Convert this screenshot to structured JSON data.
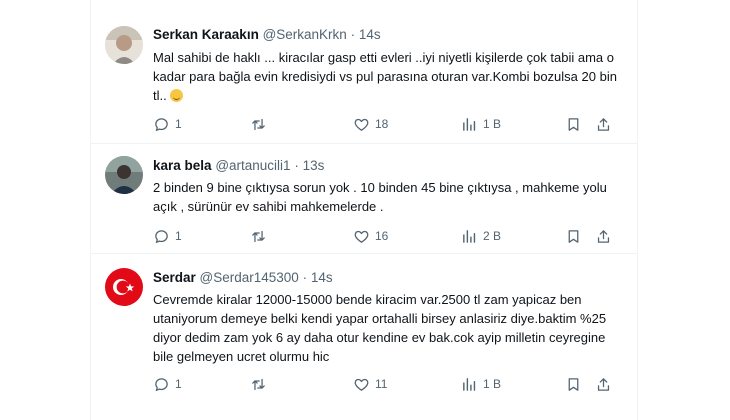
{
  "tweets": [
    {
      "name": "Serkan Karaakın",
      "handle": "@SerkanKrkn",
      "dot": "·",
      "time": "14s",
      "text": "Mal sahibi de haklı ... kiracılar gasp etti evleri ..iyi niyetli kişilerde çok tabii ama o kadar para bağla evin kredisiydi vs pul parasına oturan var.Kombi bozulsa 20 bin tl..",
      "emoji": "grinning-face",
      "replies": "1",
      "retweets": "",
      "likes": "18",
      "views": "1 B"
    },
    {
      "name": "kara bela",
      "handle": "@artanucili1",
      "dot": "·",
      "time": "13s",
      "text": "2 binden 9 bine çıktıysa sorun yok . 10 binden 45 bine çıktıysa , mahkeme yolu açık , sürünür ev sahibi mahkemelerde .",
      "replies": "1",
      "retweets": "",
      "likes": "16",
      "views": "2 B"
    },
    {
      "name": "Serdar",
      "handle": "@Serdar145300",
      "dot": "·",
      "time": "14s",
      "text": "Cevremde kiralar 12000-15000 bende kiracim var.2500 tl zam yapicaz ben utaniyorum demeye belki kendi yapar ortahalli birsey anlasiriz diye.baktim %25 diyor dedim zam yok 6 ay daha otur kendine ev bak.cok ayip milletin ceyregine bile gelmeyen ucret olurmu hic",
      "replies": "1",
      "retweets": "",
      "likes": "11",
      "views": "1 B"
    }
  ],
  "colors": {
    "text": "#0f1419",
    "muted": "#536471",
    "divider": "#eff3f4",
    "flag_red": "#e30a17"
  },
  "icons": [
    "reply-icon",
    "retweet-icon",
    "like-icon",
    "views-icon",
    "bookmark-icon",
    "share-icon"
  ]
}
